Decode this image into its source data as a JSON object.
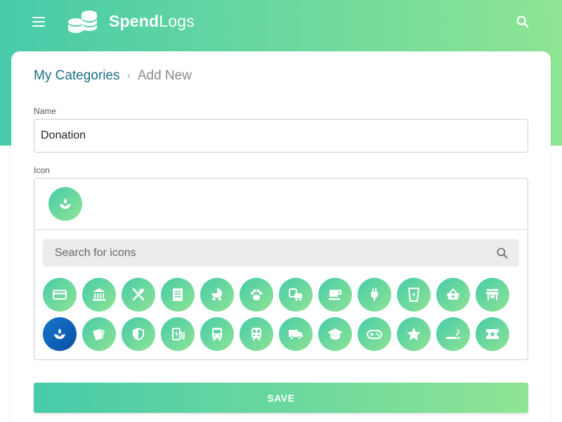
{
  "app": {
    "brand_bold": "Spend",
    "brand_regular": "Logs",
    "menu_icon": "menu-icon",
    "search_icon": "search-icon"
  },
  "colors": {
    "gradient_start": "#47cba9",
    "gradient_end": "#8ee493",
    "breadcrumb_link": "#1c6e84",
    "selected_icon": "#1577c9"
  },
  "breadcrumb": {
    "parent": "My Categories",
    "separator": "›",
    "current": "Add New"
  },
  "form": {
    "name_label": "Name",
    "name_value": "Donation",
    "icon_label": "Icon",
    "selected_icon": "donation-icon",
    "icon_search_placeholder": "Search for icons",
    "save_label": "SAVE"
  },
  "icons": [
    "credit-card-icon",
    "bank-icon",
    "restaurant-icon",
    "receipt-icon",
    "stroller-icon",
    "pet-paw-icon",
    "commute-icon",
    "coffee-icon",
    "power-plug-icon",
    "water-glass-icon",
    "shopping-basket-icon",
    "store-icon",
    "donation-icon",
    "cards-icon",
    "security-shield-icon",
    "ev-charger-icon",
    "bus-icon",
    "train-icon",
    "truck-icon",
    "education-icon",
    "gamepad-icon",
    "star-icon",
    "smoking-icon",
    "ticket-icon"
  ],
  "selected_index": 12
}
